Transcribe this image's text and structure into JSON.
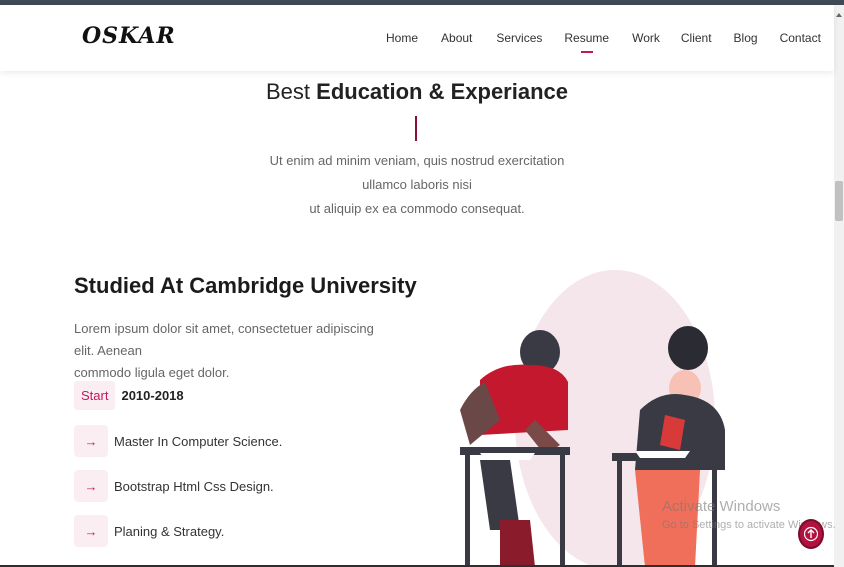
{
  "brand": {
    "logo": "OSKAR"
  },
  "nav": {
    "items": [
      {
        "label": "Home"
      },
      {
        "label": "About"
      },
      {
        "label": "Services"
      },
      {
        "label": "Resume",
        "active": true
      },
      {
        "label": "Work"
      },
      {
        "label": "Client"
      },
      {
        "label": "Blog"
      },
      {
        "label": "Contact"
      }
    ]
  },
  "section": {
    "title_light": "Best",
    "title_bold": "Education & Experiance",
    "desc_line1": "Ut enim ad minim veniam, quis nostrud exercitation ullamco laboris nisi",
    "desc_line2": "ut aliquip ex ea commodo consequat."
  },
  "education": {
    "heading": "Studied At Cambridge University",
    "para_line1": "Lorem ipsum dolor sit amet, consectetuer adipiscing elit. Aenean",
    "para_line2": "commodo ligula eget dolor.",
    "start_label": "Start",
    "years": "2010-2018",
    "items": [
      {
        "label": "Master In Computer Science."
      },
      {
        "label": "Bootstrap Html Css Design."
      },
      {
        "label": "Planing & Strategy."
      }
    ]
  },
  "watermark": {
    "line1": "Activate Windows",
    "line2": "Go to Settings to activate Windows."
  },
  "colors": {
    "accent": "#c2185b",
    "accent_dark": "#8b0d3a",
    "badge_bg": "#fbeef2"
  },
  "icons": {
    "arrow": "arrow-right-icon",
    "back_to_top": "arrow-up-circle-icon"
  }
}
